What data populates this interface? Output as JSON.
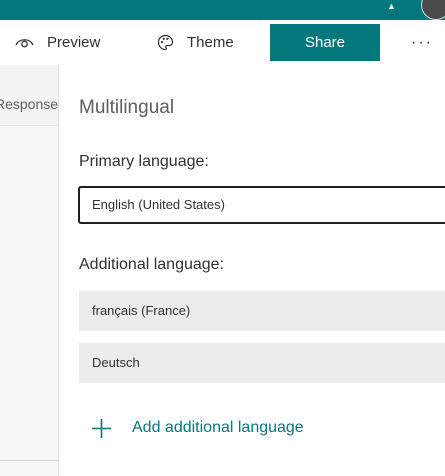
{
  "toolbar": {
    "preview_label": "Preview",
    "theme_label": "Theme",
    "share_label": "Share",
    "more_label": "···"
  },
  "sidebar": {
    "responses_tab": "Responses"
  },
  "panel": {
    "title": "Multilingual",
    "primary_label": "Primary language:",
    "primary_value": "English (United States)",
    "additional_label": "Additional language:",
    "additional_languages": [
      "français (France)",
      "Deutsch"
    ],
    "add_label": "Add additional language"
  },
  "colors": {
    "brand": "#03787c",
    "row_bg": "#ebebeb"
  }
}
